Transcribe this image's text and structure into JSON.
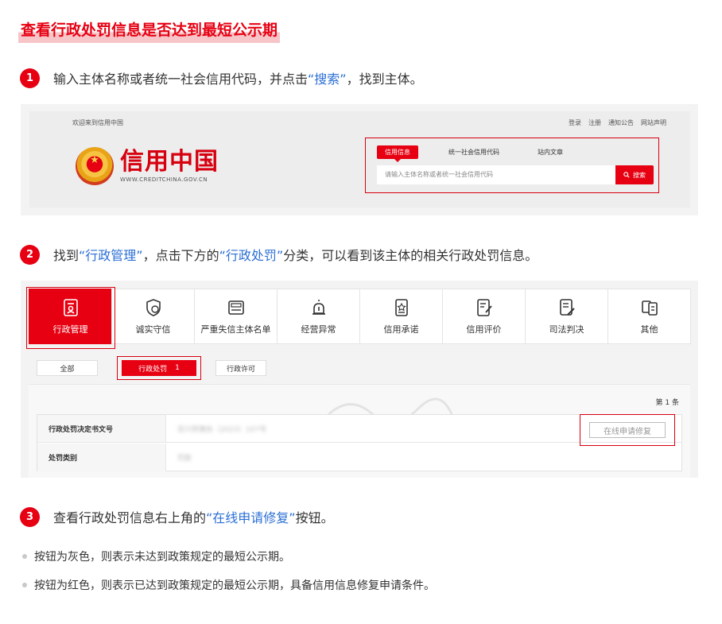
{
  "title": "查看行政处罚信息是否达到最短公示期",
  "steps": [
    {
      "num": "1",
      "pre": "输入主体名称或者统一社会信用代码，并点击",
      "hl": "“搜索”",
      "post": "，找到主体。"
    },
    {
      "num": "2",
      "pre": "找到",
      "hl": "“行政管理”",
      "mid": "，点击下方的",
      "hl2": "“行政处罚”",
      "post": "分类，可以看到该主体的相关行政处罚信息。"
    },
    {
      "num": "3",
      "pre": "查看行政处罚信息右上角的",
      "hl": "“在线申请修复”",
      "post": "按钮。"
    }
  ],
  "site": {
    "welcome": "欢迎来到信用中国",
    "top_links": [
      "登录",
      "注册",
      "通知公告",
      "网站声明"
    ],
    "logo_cn": "信用中国",
    "logo_en": "WWW.CREDITCHINA.GOV.CN",
    "search_tabs": [
      "信用信息",
      "统一社会信用代码",
      "站内文章"
    ],
    "search_placeholder": "请输入主体名称或者统一社会信用代码",
    "search_button": "搜索"
  },
  "categories": [
    "行政管理",
    "诚实守信",
    "严重失信主体名单",
    "经营异常",
    "信用承诺",
    "信用评价",
    "司法判决",
    "其他"
  ],
  "sub_tabs": {
    "all": "全部",
    "active": "行政处罚",
    "active_count": "1",
    "other": "行政许可"
  },
  "record_count": "第 1 条",
  "table": {
    "row1_label": "行政处罚决定书文号",
    "row1_value": "亚兴贸惠执〔2023〕107号",
    "row2_label": "处罚类别",
    "row2_value": "罚款"
  },
  "repair_button": "在线申请修复",
  "bullets": [
    "按钮为灰色，则表示未达到政策规定的最短公示期。",
    "按钮为红色，则表示已达到政策规定的最短公示期，具备信用信息修复申请条件。"
  ],
  "colors": {
    "brand_red": "#e60012",
    "link_blue": "#2b6fd6"
  }
}
